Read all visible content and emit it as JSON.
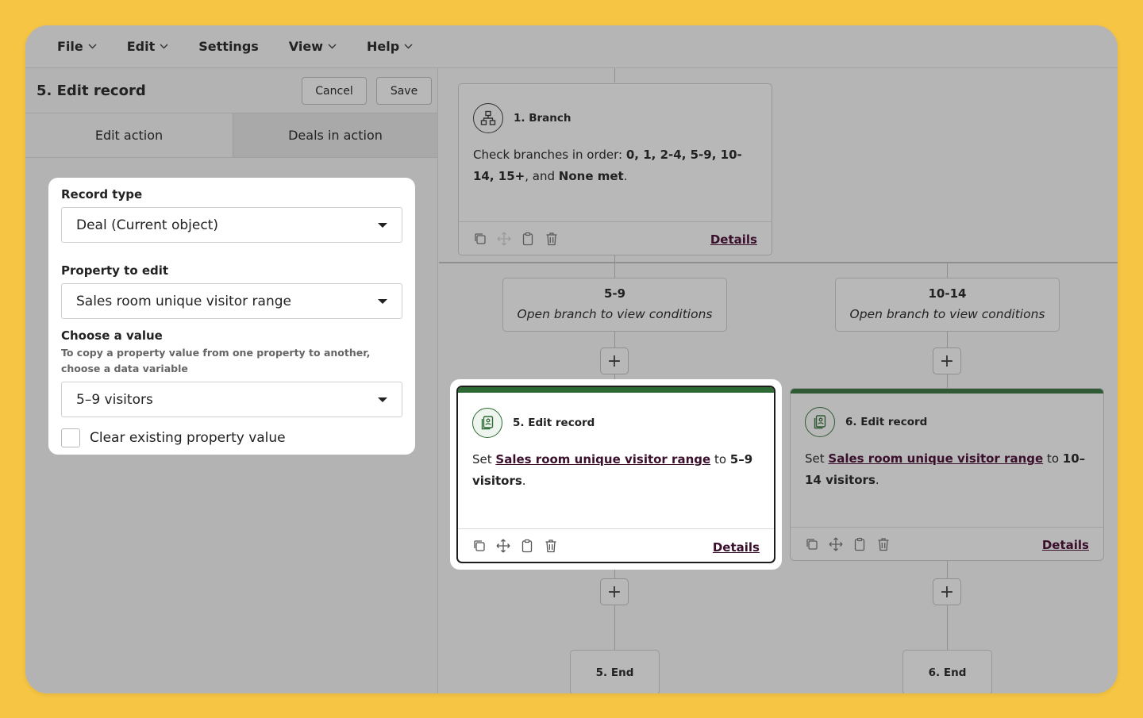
{
  "menu": {
    "items": [
      {
        "label": "File",
        "has_dropdown": true
      },
      {
        "label": "Edit",
        "has_dropdown": true
      },
      {
        "label": "Settings",
        "has_dropdown": false
      },
      {
        "label": "View",
        "has_dropdown": true
      },
      {
        "label": "Help",
        "has_dropdown": true
      }
    ]
  },
  "panel": {
    "title": "5. Edit record",
    "cancel_label": "Cancel",
    "save_label": "Save",
    "tabs": [
      {
        "label": "Edit action",
        "active": true
      },
      {
        "label": "Deals in action",
        "active": false
      }
    ],
    "form": {
      "record_type_label": "Record type",
      "record_type_value": "Deal (Current object)",
      "property_label": "Property to edit",
      "property_value": "Sales room unique visitor range",
      "value_label": "Choose a value",
      "value_help": "To copy a property value from one property to another, choose a data variable",
      "value_value": "5–9 visitors",
      "clear_label": "Clear existing property value",
      "clear_checked": false
    }
  },
  "canvas": {
    "branch_node": {
      "title": "1. Branch",
      "body_prefix": "Check branches in order: ",
      "branches_bold": "0, 1, 2-4, 5-9, 10-14, 15+",
      "body_mid": ", and ",
      "none_met": "None met",
      "body_suffix": ".",
      "details": "Details"
    },
    "branch_labels": [
      {
        "name": "5-9",
        "subtitle": "Open branch to view conditions"
      },
      {
        "name": "10-14",
        "subtitle": "Open branch to view conditions"
      }
    ],
    "edit_nodes": [
      {
        "title": "5. Edit record",
        "set": "Set ",
        "property": "Sales room unique visitor range",
        "to": " to ",
        "value": "5–9 visitors",
        "end": ".",
        "details": "Details",
        "selected": true
      },
      {
        "title": "6. Edit record",
        "set": "Set ",
        "property": "Sales room unique visitor range",
        "to": " to ",
        "value": "10–14 visitors",
        "end": ".",
        "details": "Details",
        "selected": false
      }
    ],
    "end_nodes": [
      {
        "label": "5. End"
      },
      {
        "label": "6. End"
      }
    ],
    "plus_symbol": "+"
  },
  "colors": {
    "background": "#f6c544",
    "accent_green": "#2d6a34",
    "link": "#3a0f2c"
  }
}
